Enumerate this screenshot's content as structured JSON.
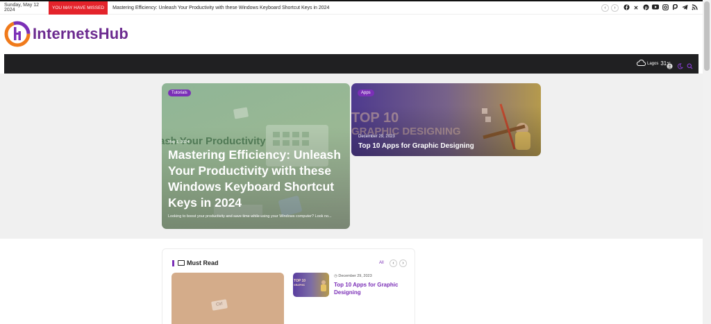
{
  "topbar": {
    "date": "Sunday, May 12 2024",
    "missed_label": "YOU MAY HAVE MISSED",
    "ticker_text": "Mastering Efficiency: Unleash Your Productivity with these Windows Keyboard Shortcut Keys in 2024",
    "prev_arrow": "‹",
    "next_arrow": "›",
    "social_icons": [
      "facebook-icon",
      "x-icon",
      "pinterest-icon",
      "youtube-icon",
      "instagram-icon",
      "patreon-icon",
      "telegram-icon",
      "rss-icon"
    ]
  },
  "logo": {
    "text": "InternetsHub"
  },
  "navbar": {
    "weather_city": "Lagos",
    "weather_temp": "31",
    "weather_unit": "℃"
  },
  "hero": {
    "card1": {
      "category": "Tutorials",
      "date": "May 1, 2024",
      "title": "Mastering Efficiency: Unleash Your Productivity with these Windows Keyboard Shortcut Keys in 2024",
      "excerpt": "Looking to boost your productivity and save time while using your Windows computer? Look no..."
    },
    "card2": {
      "category": "Apps",
      "date": "December 29, 2023",
      "title": "Top 10 Apps for Graphic Designing"
    }
  },
  "must_read": {
    "heading": "Must Read",
    "all_label": "All",
    "prev_arrow": "‹",
    "next_arrow": "›",
    "big_image_key": "Ctrl",
    "item": {
      "date": "December 29, 2023",
      "title": "Top 10 Apps for Graphic Designing"
    }
  },
  "colors": {
    "brand": "#7b2fb7",
    "missed_red": "#e4232b",
    "navbar": "#202022"
  }
}
